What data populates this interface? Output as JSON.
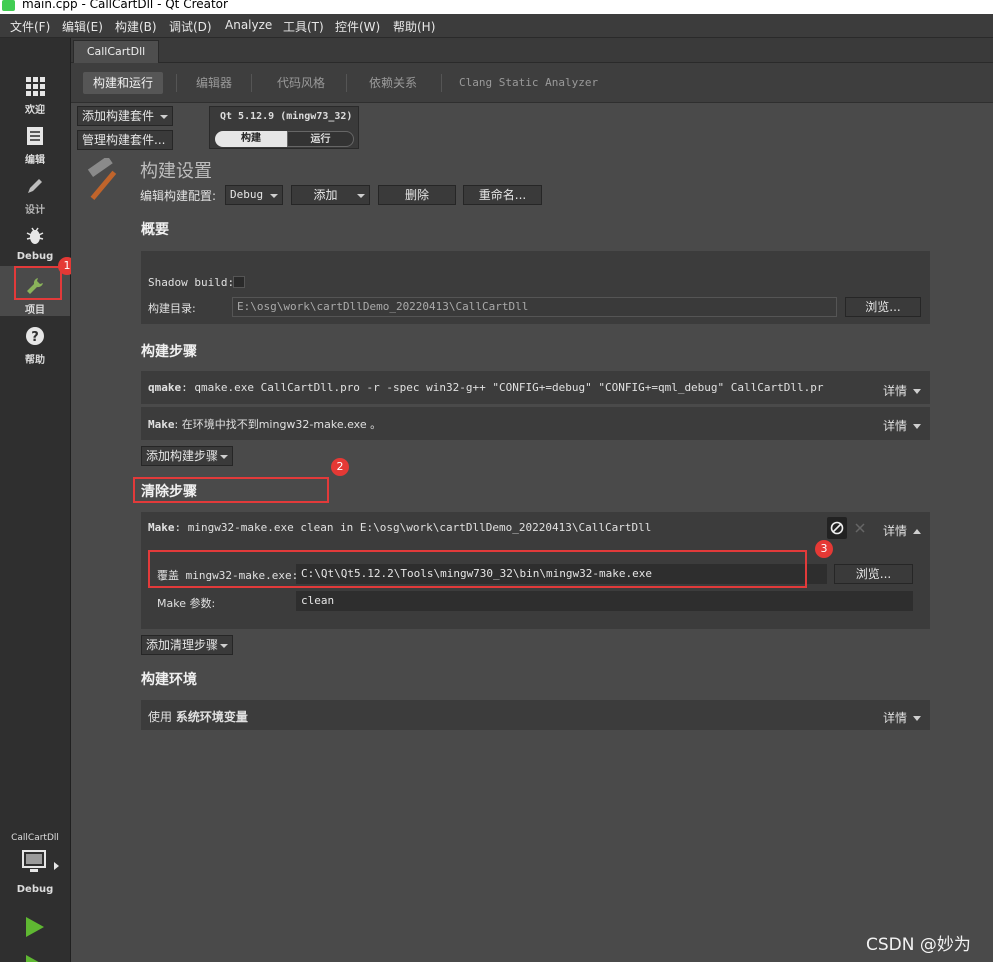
{
  "window": {
    "title": "main.cpp - CallCartDll - Qt Creator"
  },
  "menu": [
    "文件(F)",
    "编辑(E)",
    "构建(B)",
    "调试(D)",
    "Analyze",
    "工具(T)",
    "控件(W)",
    "帮助(H)"
  ],
  "sidebar": {
    "modes": [
      {
        "label": "欢迎",
        "icon": "grid-icon"
      },
      {
        "label": "编辑",
        "icon": "document-icon"
      },
      {
        "label": "设计",
        "icon": "pencil-icon"
      },
      {
        "label": "Debug",
        "icon": "bug-icon"
      },
      {
        "label": "项目",
        "icon": "wrench-icon"
      },
      {
        "label": "帮助",
        "icon": "question-icon"
      }
    ],
    "target_project": "CallCartDll",
    "target_config": "Debug"
  },
  "project_tab": "CallCartDll",
  "mode_tabs": [
    "构建和运行",
    "编辑器",
    "代码风格",
    "依赖关系",
    "Clang Static Analyzer"
  ],
  "kit": {
    "add_kit": "添加构建套件",
    "manage_kits": "管理构建套件...",
    "name": "Qt 5.12.9 (mingw73_32)",
    "build": "构建",
    "run": "运行"
  },
  "build_settings": {
    "title": "构建设置",
    "edit_config_label": "编辑构建配置:",
    "config_value": "Debug",
    "add": "添加",
    "delete": "删除",
    "rename": "重命名..."
  },
  "overview": {
    "title": "概要",
    "shadow_build_label": "Shadow build:",
    "build_dir_label": "构建目录:",
    "build_dir_value": "E:\\osg\\work\\cartDllDemo_20220413\\CallCartDll",
    "browse": "浏览..."
  },
  "build_steps": {
    "title": "构建步骤",
    "steps": [
      {
        "name": "qmake",
        "text": ": qmake.exe CallCartDll.pro -r -spec win32-g++ \"CONFIG+=debug\" \"CONFIG+=qml_debug\" CallCartDll.pr",
        "details": "详情"
      },
      {
        "name": "Make",
        "text": ": 在环境中找不到mingw32-make.exe 。",
        "details": "详情"
      }
    ],
    "add_step": "添加构建步骤"
  },
  "clean_steps": {
    "title": "清除步骤",
    "step_name": "Make",
    "step_text": ": mingw32-make.exe clean in E:\\osg\\work\\cartDllDemo_20220413\\CallCartDll",
    "details": "详情",
    "override_label": "覆盖 mingw32-make.exe:",
    "override_value": "C:\\Qt\\Qt5.12.2\\Tools\\mingw730_32\\bin\\mingw32-make.exe",
    "browse": "浏览...",
    "make_args_label": "Make 参数:",
    "make_args_value": "clean",
    "add_step": "添加清理步骤"
  },
  "build_env": {
    "title": "构建环境",
    "use": "使用",
    "system_env": "系统环境变量",
    "details": "详情"
  },
  "annotations": [
    "1",
    "2",
    "3"
  ],
  "watermark": "CSDN @妙为",
  "colors": {
    "accent_green": "#8ab35a",
    "annotation_red": "#e23a3a",
    "run_green": "#5fb832"
  }
}
